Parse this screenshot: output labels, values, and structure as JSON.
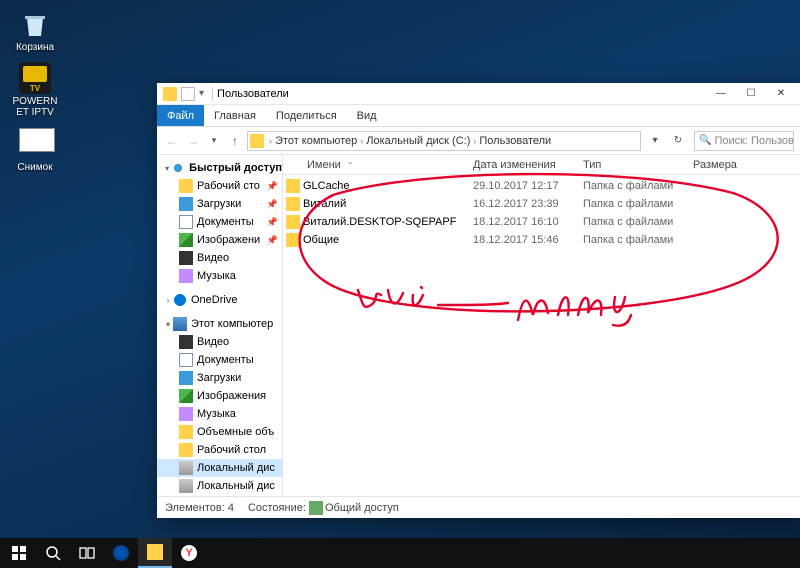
{
  "desktop": {
    "bin": "Корзина",
    "tv": "POWERNET IPTV",
    "snip": "Снимок"
  },
  "window": {
    "title": "Пользователи",
    "ribbon": {
      "file": "Файл",
      "home": "Главная",
      "share": "Поделиться",
      "view": "Вид"
    },
    "breadcrumb": {
      "pc": "Этот компьютер",
      "drive": "Локальный диск (C:)",
      "folder": "Пользователи"
    },
    "search_placeholder": "Поиск: Пользова",
    "columns": {
      "name": "Имени",
      "date": "Дата изменения",
      "type": "Тип",
      "size": "Размера"
    },
    "files": [
      {
        "name": "GLCache",
        "date": "29.10.2017 12:17",
        "type": "Папка с файлами"
      },
      {
        "name": "Виталий",
        "date": "16.12.2017 23:39",
        "type": "Папка с файлами"
      },
      {
        "name": "Виталий.DESKTOP-SQEPAPF",
        "date": "18.12.2017 16:10",
        "type": "Папка с файлами"
      },
      {
        "name": "Общие",
        "date": "18.12.2017 15:46",
        "type": "Папка с файлами"
      }
    ],
    "nav": {
      "quick": "Быстрый доступ",
      "quick_items": [
        "Рабочий сто",
        "Загрузки",
        "Документы",
        "Изображени",
        "Видео",
        "Музыка"
      ],
      "onedrive": "OneDrive",
      "thispc": "Этот компьютер",
      "pc_items": [
        "Видео",
        "Документы",
        "Загрузки",
        "Изображения",
        "Музыка",
        "Объемные объ",
        "Рабочий стол",
        "Локальный дис",
        "Локальный дис"
      ]
    },
    "status": {
      "count": "Элементов: 4",
      "state_label": "Состояние:",
      "state_value": "Общий доступ"
    }
  }
}
